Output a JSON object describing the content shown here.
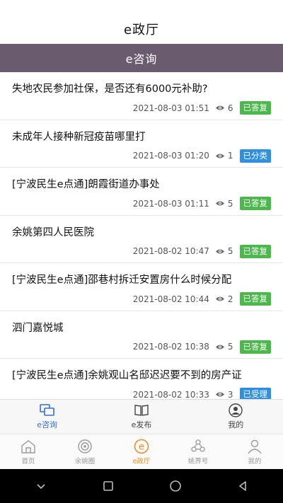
{
  "app": {
    "title": "e政厅"
  },
  "section": {
    "title": "e咨询"
  },
  "items": [
    {
      "title": "失地农民参加社保，是否还有6000元补助?",
      "time": "2021-08-03 01:51",
      "views": "6",
      "status": "已答复",
      "status_color": "#4cb84c"
    },
    {
      "title": "未成年人接种新冠疫苗哪里打",
      "time": "2021-08-03 01:20",
      "views": "1",
      "status": "已分类",
      "status_color": "#2f8fe0"
    },
    {
      "title": "[宁波民生e点通]朗霞街道办事处",
      "time": "2021-08-03 01:11",
      "views": "5",
      "status": "已答复",
      "status_color": "#4cb84c"
    },
    {
      "title": "余姚第四人民医院",
      "time": "2021-08-02 10:47",
      "views": "5",
      "status": "已答复",
      "status_color": "#4cb84c"
    },
    {
      "title": "[宁波民生e点通]邵巷村拆迁安置房什么时候分配",
      "time": "2021-08-02 10:44",
      "views": "2",
      "status": "已答复",
      "status_color": "#4cb84c"
    },
    {
      "title": "泗门嘉悦城",
      "time": "2021-08-02 10:38",
      "views": "5",
      "status": "已答复",
      "status_color": "#4cb84c"
    },
    {
      "title": "[宁波民生e点通]余姚观山名邸迟迟要不到的房产证",
      "time": "2021-08-02 10:33",
      "views": "3",
      "status": "已受理",
      "status_color": "#2f8fe0"
    }
  ],
  "tabs": [
    {
      "label": "e咨询",
      "icon": "chat-icon",
      "active": true
    },
    {
      "label": "e发布",
      "icon": "book-icon",
      "active": false
    },
    {
      "label": "我的",
      "icon": "user-icon",
      "active": false
    }
  ],
  "bottom_nav": [
    {
      "label": "首页",
      "icon": "home-icon"
    },
    {
      "label": "余姚圈",
      "icon": "circle-icon"
    },
    {
      "label": "e政厅",
      "icon": "e-icon",
      "active": true
    },
    {
      "label": "姚界号",
      "icon": "people-icon"
    },
    {
      "label": "我的",
      "icon": "person-icon"
    }
  ],
  "colors": {
    "header_bg": "#6b5b6e",
    "active_tab": "#2e6fd6",
    "active_nav": "#e88b2a"
  }
}
